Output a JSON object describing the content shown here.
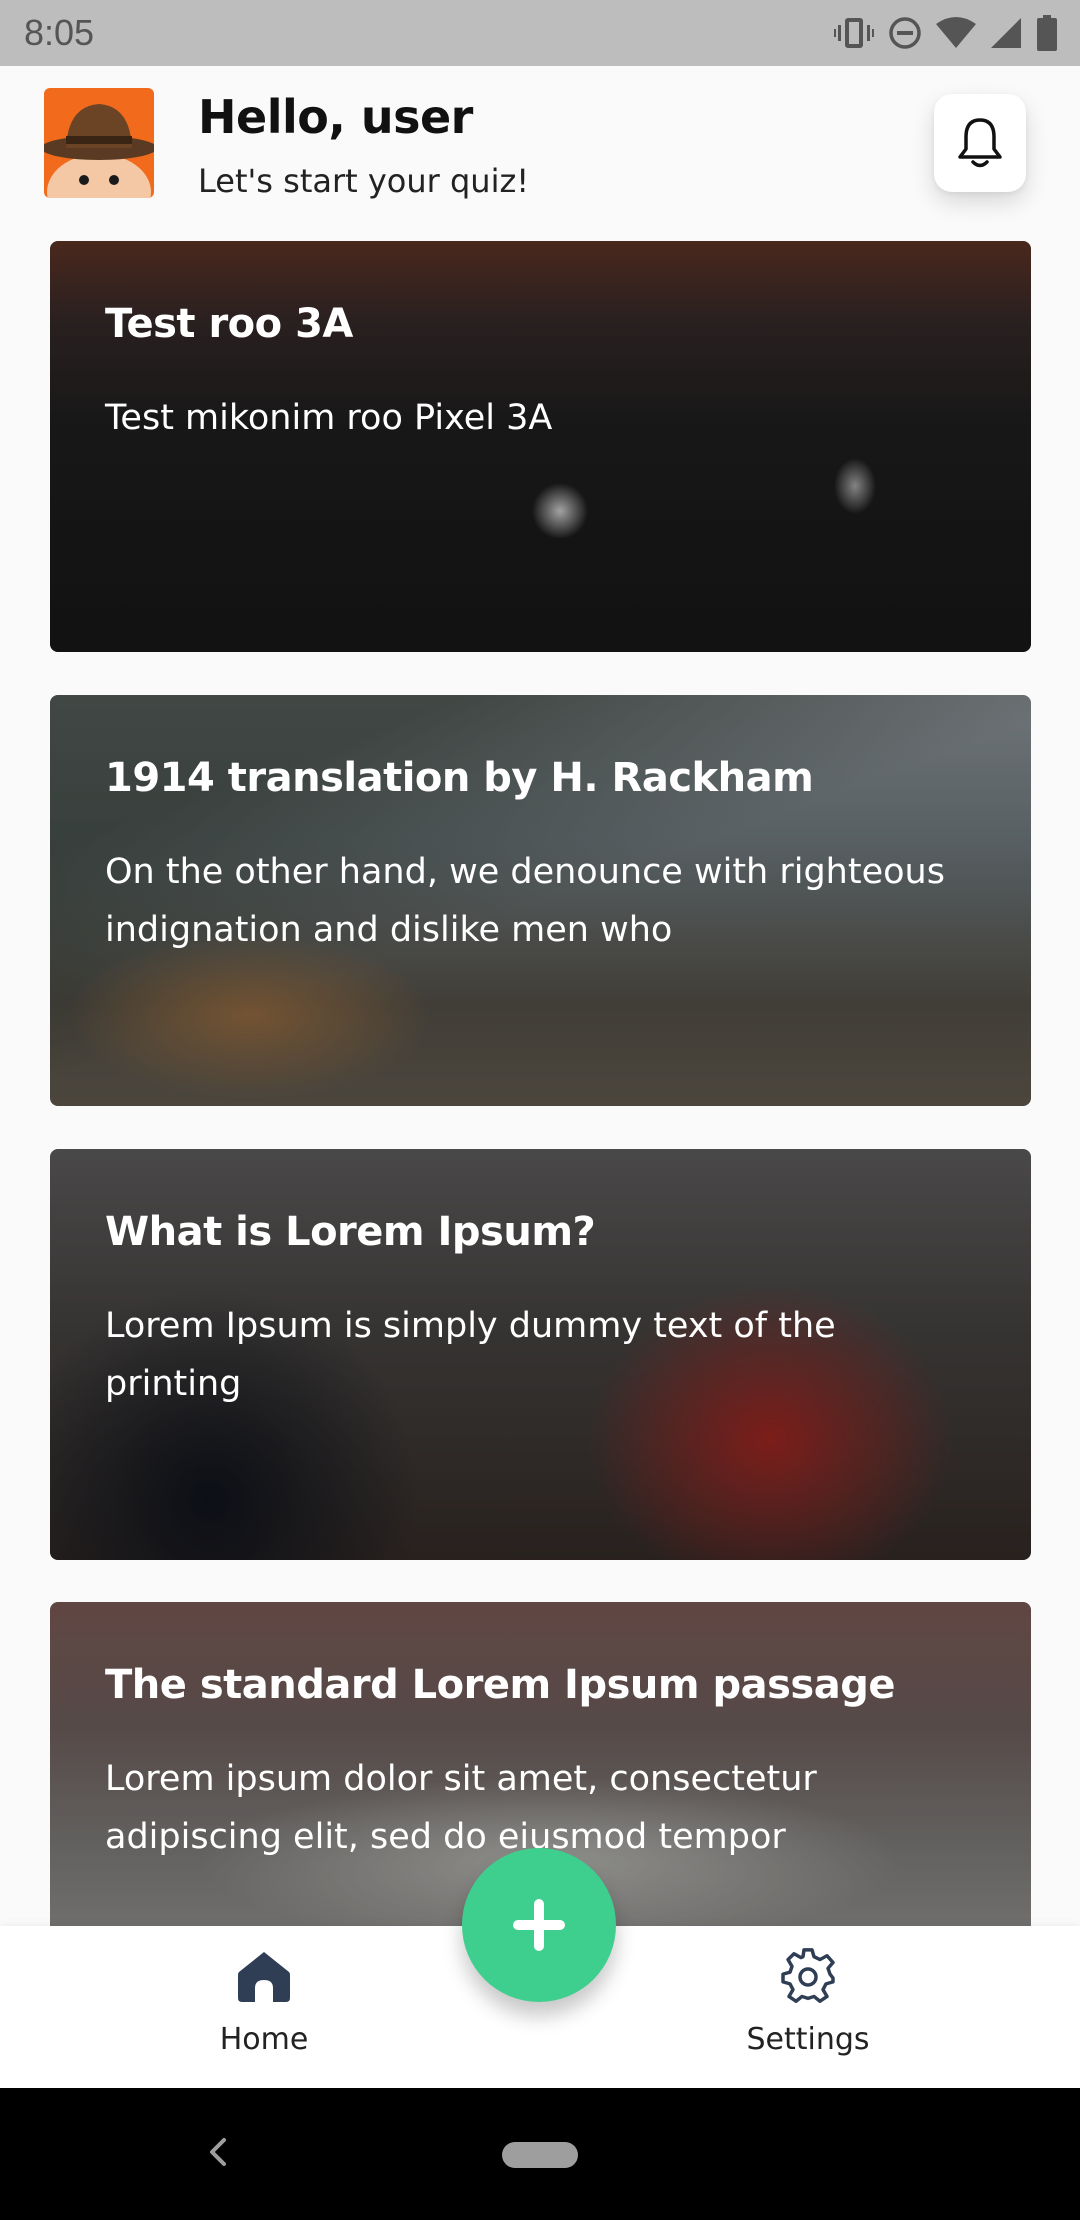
{
  "status_bar": {
    "time": "8:05",
    "icons": [
      "vibrate-icon",
      "do-not-disturb-icon",
      "wifi-icon",
      "signal-icon",
      "battery-icon"
    ]
  },
  "header": {
    "greeting": "Hello, user",
    "subtitle": "Let's start your quiz!",
    "avatar_icon": "avatar-character-icon",
    "notification_icon": "bell-icon"
  },
  "quizzes": [
    {
      "title": "Test roo 3A",
      "description": "Test mikonim roo Pixel 3A"
    },
    {
      "title": "1914 translation by H. Rackham",
      "description": "On the other hand, we denounce with righteous indignation and dislike men who"
    },
    {
      "title": "What is Lorem Ipsum?",
      "description": "Lorem Ipsum is simply dummy text of the printing"
    },
    {
      "title": "The standard Lorem Ipsum passage",
      "description": "Lorem ipsum dolor sit amet, consectetur adipiscing elit, sed do eiusmod tempor"
    }
  ],
  "fab": {
    "icon": "plus-icon"
  },
  "bottom_nav": {
    "home_label": "Home",
    "settings_label": "Settings"
  },
  "colors": {
    "accent": "#3ecf8e",
    "nav_icon": "#2f3e55",
    "avatar_bg": "#f26b1d"
  }
}
